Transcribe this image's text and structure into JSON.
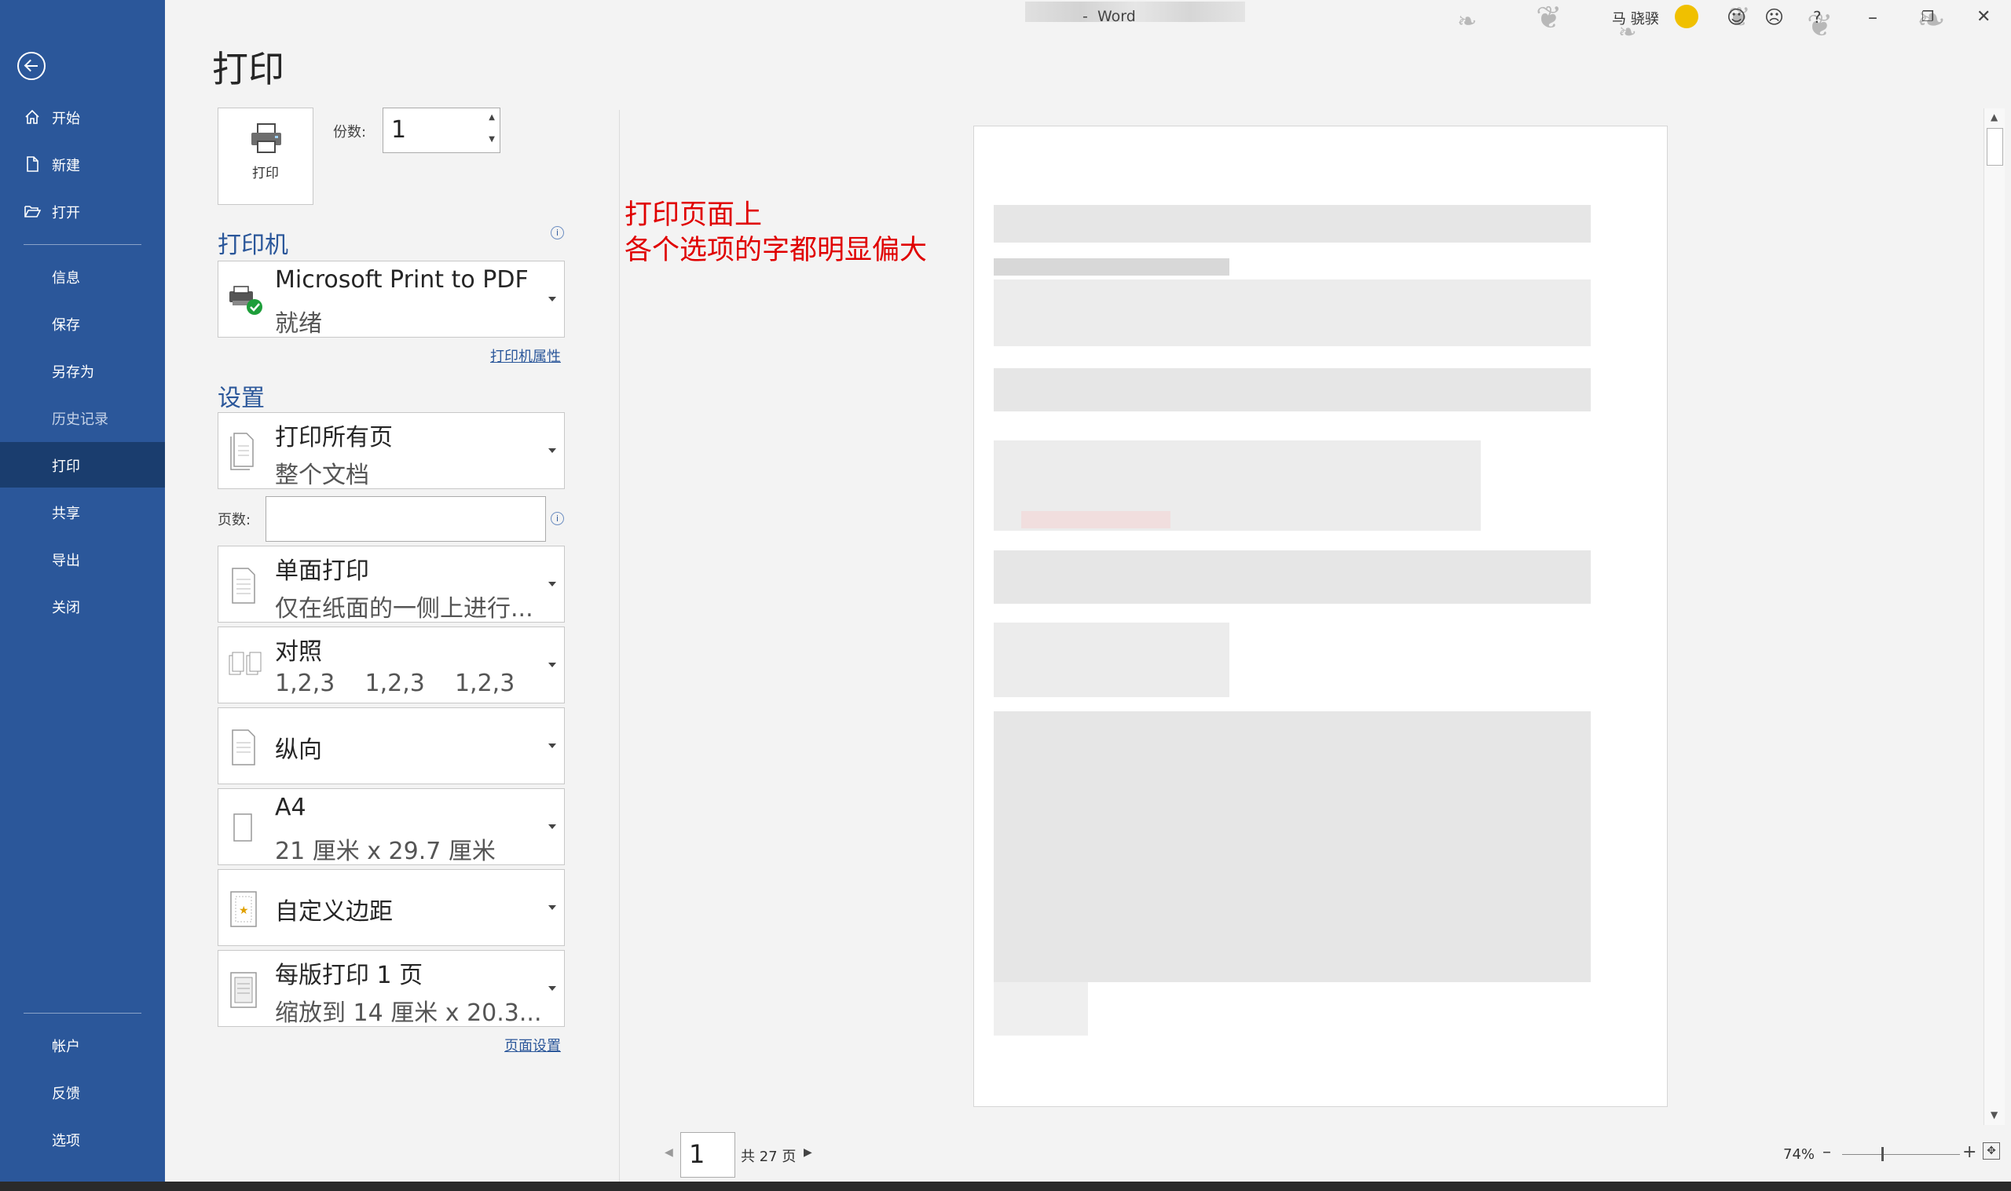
{
  "window": {
    "app_name": "Word",
    "title_separator": "-",
    "user_name": "马 骁骙"
  },
  "sidebar": {
    "top_items": [
      {
        "label": "开始",
        "icon": "home-icon"
      },
      {
        "label": "新建",
        "icon": "new-document-icon"
      },
      {
        "label": "打开",
        "icon": "open-folder-icon"
      }
    ],
    "items": [
      {
        "label": "信息"
      },
      {
        "label": "保存"
      },
      {
        "label": "另存为"
      },
      {
        "label": "历史记录"
      },
      {
        "label": "打印"
      },
      {
        "label": "共享"
      },
      {
        "label": "导出"
      },
      {
        "label": "关闭"
      }
    ],
    "bottom_items": [
      {
        "label": "帐户"
      },
      {
        "label": "反馈"
      },
      {
        "label": "选项"
      }
    ]
  },
  "print": {
    "page_title": "打印",
    "print_button_label": "打印",
    "copies_label": "份数:",
    "copies_value": "1"
  },
  "printer": {
    "heading": "打印机",
    "name": "Microsoft Print to PDF",
    "status": "就绪",
    "properties_link": "打印机属性"
  },
  "settings": {
    "heading": "设置",
    "range_title": "打印所有页",
    "range_subtitle": "整个文档",
    "pages_label": "页数:",
    "pages_value": "",
    "sides_title": "单面打印",
    "sides_subtitle": "仅在纸面的一侧上进行...",
    "collate_title": "对照",
    "collate_subtitle": "1,2,3    1,2,3    1,2,3",
    "orientation_title": "纵向",
    "paper_title": "A4",
    "paper_subtitle": "21 厘米 x 29.7 厘米",
    "margins_title": "自定义边距",
    "per_sheet_title": "每版打印 1 页",
    "per_sheet_subtitle": "缩放到 14 厘米 x 20.3...",
    "page_setup_link": "页面设置"
  },
  "annotation": {
    "line1": "打印页面上",
    "line2": "各个选项的字都明显偏大"
  },
  "preview": {
    "current_page": "1",
    "total_pages": "共 27 页",
    "zoom": "74%"
  },
  "colors": {
    "sidebar_bg": "#2b579a",
    "accent": "#2b579a",
    "annotation": "#e00000"
  }
}
